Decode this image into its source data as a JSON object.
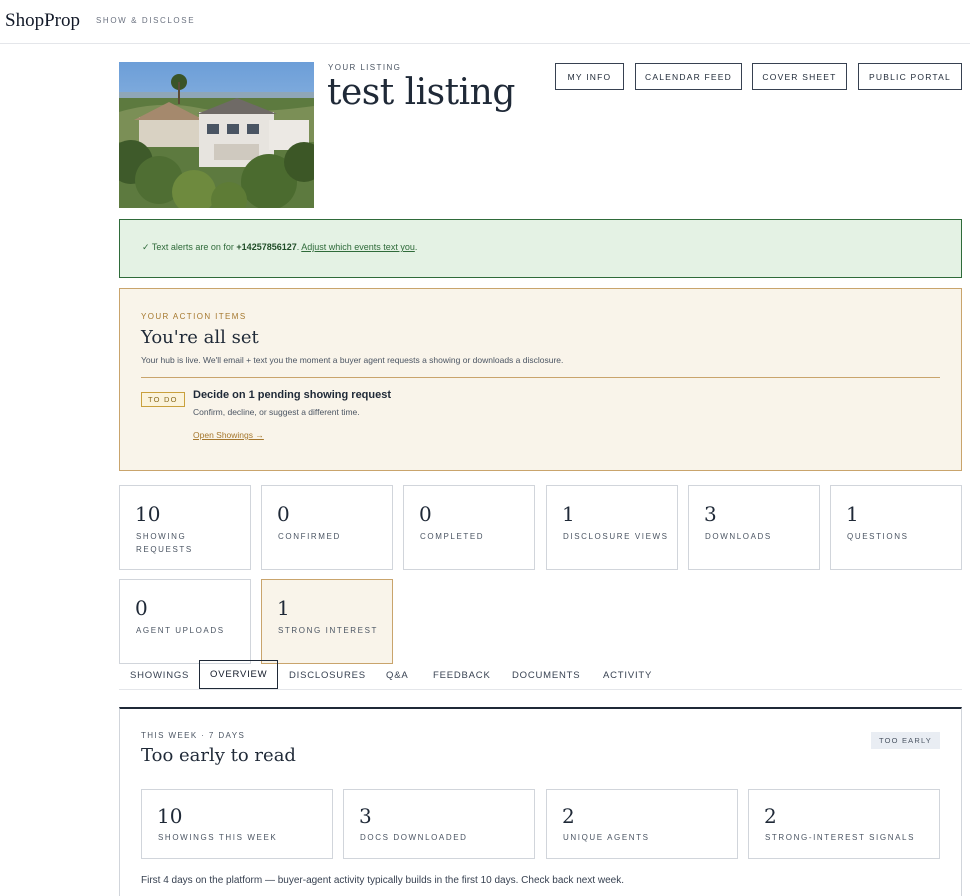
{
  "header": {
    "logo": "ShopProp",
    "tagline": "SHOW & DISCLOSE"
  },
  "listing": {
    "eyebrow": "YOUR LISTING",
    "title": "test listing",
    "buttons": {
      "my_info": "MY INFO",
      "calendar_feed": "CALENDAR FEED",
      "cover_sheet": "COVER SHEET",
      "public_portal": "PUBLIC PORTAL"
    }
  },
  "alert": {
    "prefix": "✓ Text alerts are on for ",
    "phone": "+14257856127",
    "suffix": ". ",
    "link": "Adjust which events text you",
    "end": "."
  },
  "actions": {
    "eyebrow": "YOUR ACTION ITEMS",
    "title": "You're all set",
    "description": "Your hub is live. We'll email + text you the moment a buyer agent requests a showing or downloads a disclosure.",
    "todo": {
      "badge": "TO DO",
      "title": "Decide on 1 pending showing request",
      "subtitle": "Confirm, decline, or suggest a different time.",
      "link": "Open Showings →"
    }
  },
  "stats": [
    {
      "value": "10",
      "label": "SHOWING REQUESTS"
    },
    {
      "value": "0",
      "label": "CONFIRMED"
    },
    {
      "value": "0",
      "label": "COMPLETED"
    },
    {
      "value": "1",
      "label": "DISCLOSURE VIEWS"
    },
    {
      "value": "3",
      "label": "DOWNLOADS"
    },
    {
      "value": "1",
      "label": "QUESTIONS"
    },
    {
      "value": "0",
      "label": "AGENT UPLOADS"
    },
    {
      "value": "1",
      "label": "STRONG INTEREST"
    }
  ],
  "tabs": [
    {
      "label": "SHOWINGS"
    },
    {
      "label": "OVERVIEW"
    },
    {
      "label": "DISCLOSURES"
    },
    {
      "label": "Q&A"
    },
    {
      "label": "FEEDBACK"
    },
    {
      "label": "DOCUMENTS"
    },
    {
      "label": "ACTIVITY"
    }
  ],
  "active_tab": "OVERVIEW",
  "overview": {
    "eyebrow": "THIS WEEK · 7 DAYS",
    "title": "Too early to read",
    "badge": "TOO EARLY",
    "metrics": [
      {
        "value": "10",
        "label": "SHOWINGS THIS WEEK"
      },
      {
        "value": "3",
        "label": "DOCS DOWNLOADED"
      },
      {
        "value": "2",
        "label": "UNIQUE AGENTS"
      },
      {
        "value": "2",
        "label": "STRONG-INTEREST SIGNALS"
      }
    ],
    "footnote": "First 4 days on the platform — buyer-agent activity typically builds in the first 10 days. Check back next week."
  },
  "colors": {
    "alert_bg": "#e4f2e4",
    "alert_border": "#2f6b3a",
    "action_bg": "#f9f4ea",
    "action_border": "#c9a46c",
    "ink": "#1f2937"
  },
  "photo_icon": "listing-photo"
}
